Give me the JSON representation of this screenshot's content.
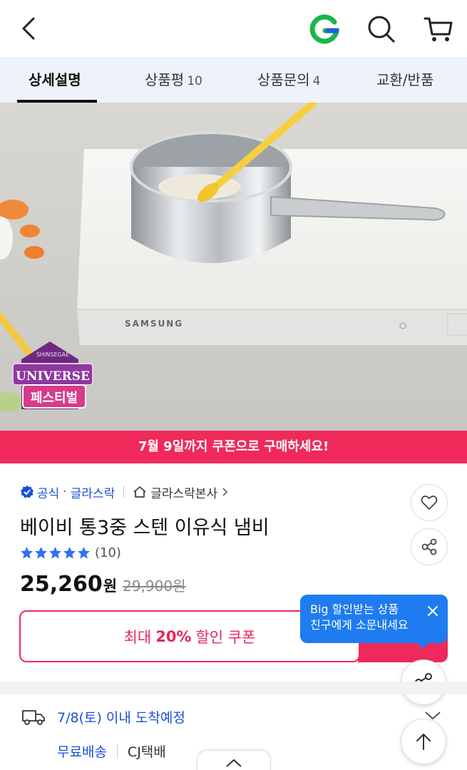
{
  "header": {
    "back_icon": "chevron-left-icon",
    "gmarket_icon": "g-logo-icon",
    "search_icon": "search-icon",
    "cart_icon": "cart-icon"
  },
  "tabs": [
    {
      "label": "상세설명",
      "count": "",
      "active": true
    },
    {
      "label": "상품평",
      "count": "10",
      "active": false
    },
    {
      "label": "상품문의",
      "count": "4",
      "active": false
    },
    {
      "label": "교환/반품",
      "count": "",
      "active": false
    }
  ],
  "hero": {
    "appliance_brand": "SAMSUNG",
    "badge_top": "SHINSEGAE",
    "badge_middle": "UNIVERSE",
    "badge_bottom": "페스티벌"
  },
  "coupon_banner": {
    "text": "7월 9일까지 쿠폰으로 구매하세요!"
  },
  "product": {
    "official_label": "공식",
    "brand": "글라스락",
    "store": "글라스락본사",
    "title": "베이비 통3중 스텐 이유식 냄비",
    "rating_stars": 5,
    "review_count": "(10)",
    "price": "25,260",
    "price_unit": "원",
    "original_price": "29,900원"
  },
  "coupon_button": {
    "prefix": "최대",
    "percent": "20%",
    "suffix": "할인 쿠폰"
  },
  "tooltip": {
    "line1": "Big 할인받는 상품",
    "line2": "친구에게 소문내세요"
  },
  "shipping": {
    "date_text": "7/8(토) 이내 도착예정",
    "fee": "무료배송",
    "carrier": "CJ택배"
  },
  "colors": {
    "accent_red": "#f0295b",
    "link_blue": "#1a4fd6",
    "tooltip_blue": "#1e7cf0",
    "star_blue": "#2f6ff0"
  }
}
